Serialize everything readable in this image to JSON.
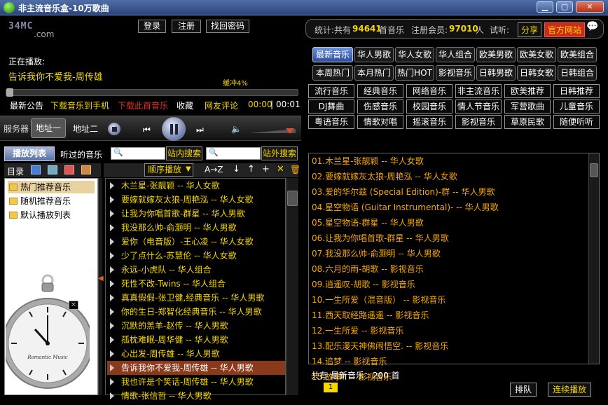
{
  "window": {
    "title": "非主流音乐盒-10万歌曲"
  },
  "logo": {
    "line1": "34MC",
    "line2": ".com"
  },
  "auth": {
    "login": "登录",
    "register": "注册",
    "recover": "找回密码"
  },
  "stats": {
    "text1": "统计:共有",
    "song_count": "94641",
    "text2": "首音乐",
    "text3": "注册会员:",
    "member_count": "97010",
    "text4": "人",
    "trial": "试听:",
    "share": "分享",
    "official": "官方网站"
  },
  "player": {
    "now_label": "正在播放:",
    "now_song": "告诉我你不爱我-周传雄",
    "buffer": "缓冲4%",
    "notice": "最新公告",
    "download_phone": "下载音乐到手机",
    "download_song": "下载此首音乐",
    "favorite": "收藏",
    "comment": "网友评论",
    "elapsed": "00:00",
    "duration": "00:01",
    "progress_fraction": 0
  },
  "controls": {
    "server": "服务器",
    "addr1": "地址一",
    "addr2": "地址二"
  },
  "left_tabs": {
    "playlist": "播放列表",
    "history": "听过的音乐",
    "site_search": "站内搜索",
    "web_search": "站外搜索"
  },
  "dir": {
    "label": "目录",
    "play_mode": "顺序播放",
    "sort": "A→Z"
  },
  "folders": [
    "热门推荐音乐",
    "随机推荐音乐",
    "默认播放列表"
  ],
  "playlist": [
    "木兰星-张靓颖 -- 华人女歌",
    "要嫁就嫁灰太狼-周艳泓 -- 华人女歌",
    "让我为你唱首歌-群星 -- 华人男歌",
    "我没那么帅-俞灏明 -- 华人男歌",
    "爱你（电音版）-王心凌 -- 华人女歌",
    "少了点什么-苏慧伦 -- 华人女歌",
    "永远-小虎队 -- 华人组合",
    "死性不改-Twins -- 华人组合",
    "真真假假-张卫健,经典音乐 -- 华人男歌",
    "你的生日-郑智化经典音乐 -- 华人男歌",
    "沉默的羔羊-赵传 -- 华人男歌",
    "孤枕难眠-周华健 -- 华人男歌",
    "心出发-周传雄 -- 华人男歌",
    "告诉我你不爱我-周传雄 -- 华人男歌",
    "我也许是个笑话-周传雄 -- 华人男歌",
    "情歌-张信哲 -- 华人男歌"
  ],
  "playlist_selected": 13,
  "category_tabs_row1": [
    "最新音乐",
    "华人男歌",
    "华人女歌",
    "华人组合",
    "欧美男歌",
    "欧美女歌",
    "欧美组合"
  ],
  "category_tabs_row2": [
    "本周热门",
    "本月热门",
    "热门HOT",
    "影视音乐",
    "日韩男歌",
    "日韩女歌",
    "日韩组合"
  ],
  "genres": [
    "流行音乐",
    "经典音乐",
    "网络音乐",
    "非主流音乐",
    "欧美推荐",
    "日韩推荐",
    "DJ舞曲",
    "伤感音乐",
    "校园音乐",
    "情人节音乐",
    "军营歌曲",
    "儿童音乐",
    "粤语音乐",
    "情歌对唱",
    "摇滚音乐",
    "影视音乐",
    "草原民歌",
    "随便听听"
  ],
  "songs": [
    "01.木兰星-张靓颖 -- 华人女歌",
    "02.要嫁就嫁灰太狼-周艳泓 -- 华人女歌",
    "03.爱的华尔兹 (Special Edition)-群 -- 华人男歌",
    "04.星空物语 (Guitar Instrumental)- -- 华人男歌",
    "05.星空物语-群星 -- 华人男歌",
    "06.让我为你唱首歌-群星 -- 华人男歌",
    "07.我没那么帅-俞灏明 -- 华人男歌",
    "08.六月的雨-胡歌 -- 影视音乐",
    "09.逍遥叹-胡歌 -- 影视音乐",
    "10.一生所爱（混音版） -- 影视音乐",
    "11.西天取经路遥遥 -- 影视音乐",
    "12.一生所爱 -- 影视音乐",
    "13.配乐漫天神佛闹悟空. -- 影视音乐",
    "14.追梦 -- 影视音乐",
    "15.故事II -- 影视音乐"
  ],
  "footer": {
    "total": "共有  最新音乐：200 首",
    "page": "1",
    "queue": "排队",
    "continuous": "连续播放"
  },
  "watch": {
    "brand": "Romantic Music"
  },
  "colors": {
    "accent": "#f6d800",
    "song_text": "#f6a800",
    "selected_row": "#8a3a1a"
  }
}
